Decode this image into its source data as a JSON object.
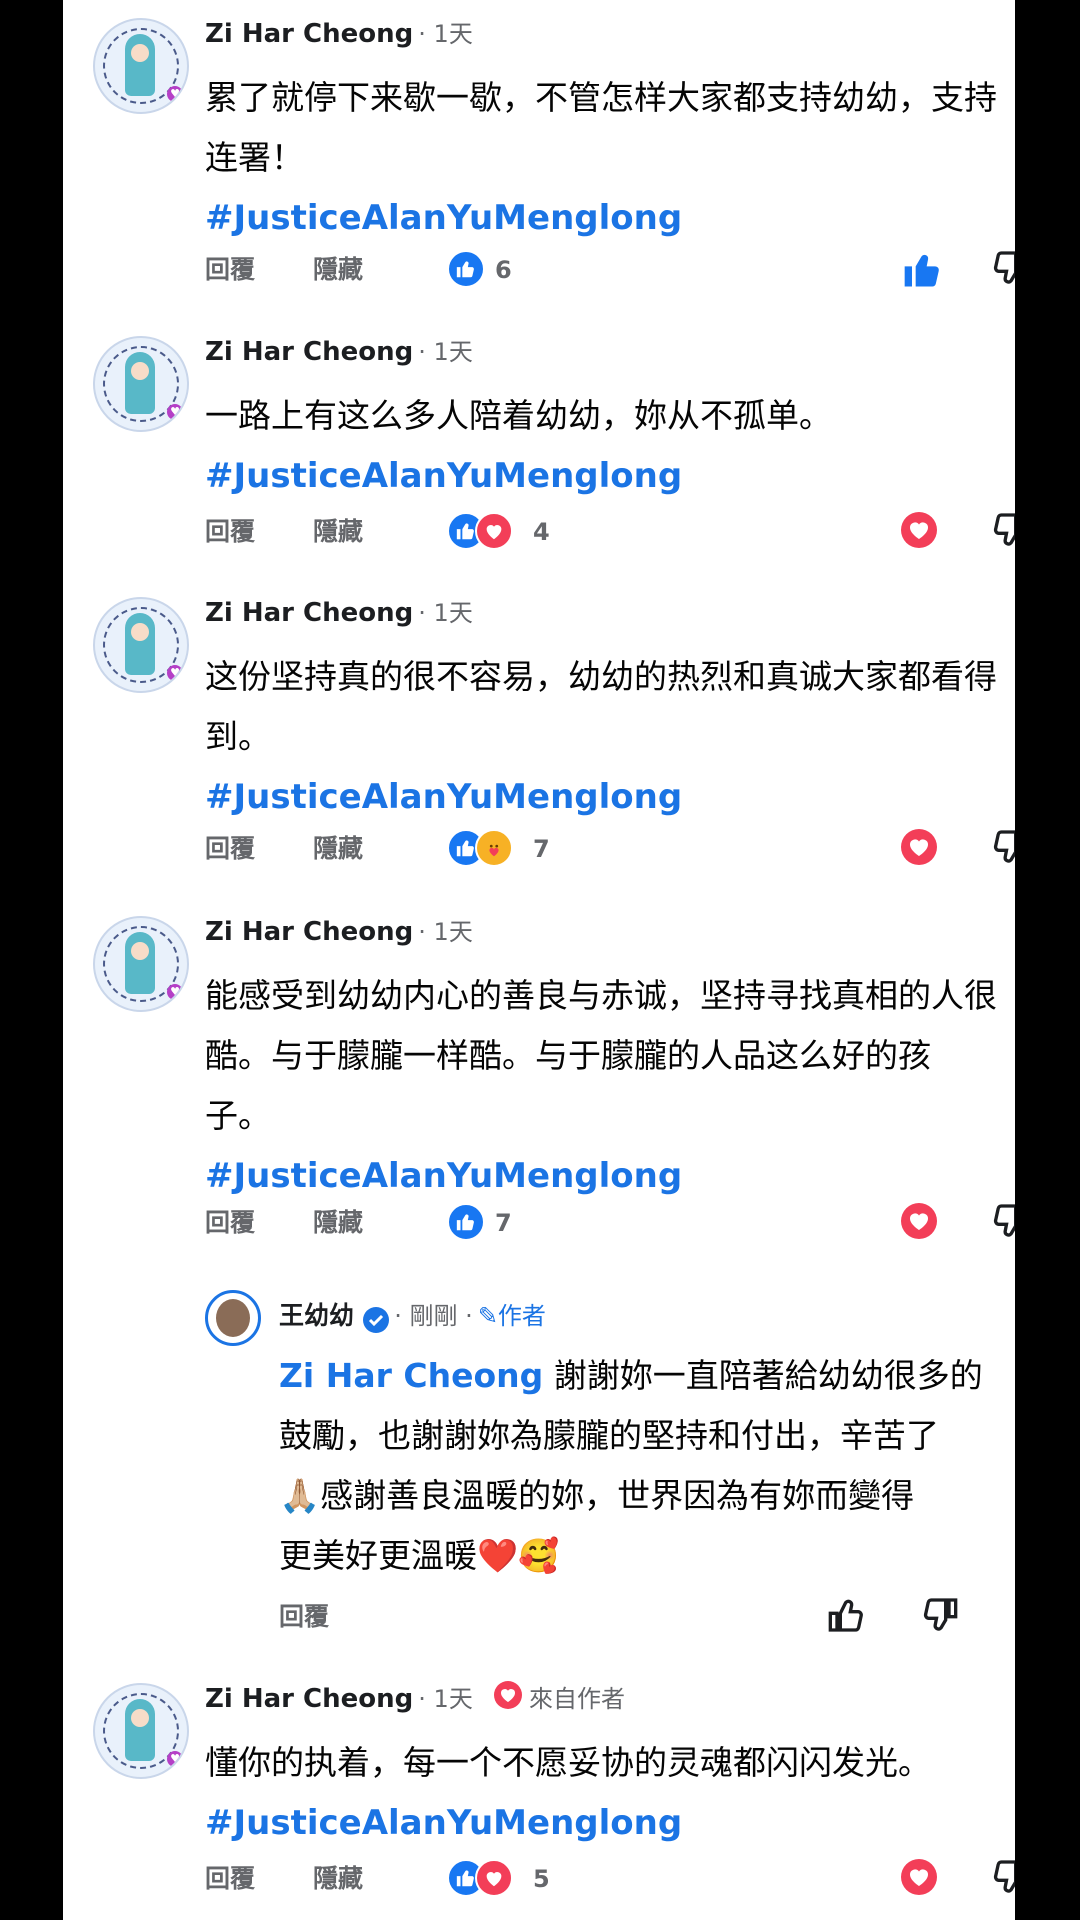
{
  "comments": [
    {
      "author": "Zi Har Cheong",
      "time": "· 1天",
      "text": "累了就停下来歇一歇，不管怎样大家都支持幼幼，支持连署！",
      "hashtag": "#JusticeAlanYuMenglong",
      "reply_label": "回覆",
      "hide_label": "隱藏",
      "reaction_count": "6"
    },
    {
      "author": "Zi Har Cheong",
      "time": "· 1天",
      "text": "一路上有这么多人陪着幼幼，妳从不孤单。",
      "hashtag": "#JusticeAlanYuMenglong",
      "reply_label": "回覆",
      "hide_label": "隱藏",
      "reaction_count": "4"
    },
    {
      "author": "Zi Har Cheong",
      "time": "· 1天",
      "text": "这份坚持真的很不容易，幼幼的热烈和真诚大家都看得到。",
      "hashtag": "#JusticeAlanYuMenglong",
      "reply_label": "回覆",
      "hide_label": "隱藏",
      "reaction_count": "7"
    },
    {
      "author": "Zi Har Cheong",
      "time": "· 1天",
      "text": "能感受到幼幼内心的善良与赤诚，坚持寻找真相的人很酷。与于朦朧一样酷。与于朦朧的人品这么好的孩 子。",
      "hashtag": "#JusticeAlanYuMenglong",
      "reply_label": "回覆",
      "hide_label": "隱藏",
      "reaction_count": "7"
    },
    {
      "author": "Zi Har Cheong",
      "time": "· 1天",
      "loved_by_author": "來自作者",
      "text": "懂你的执着，每一个不愿妥协的灵魂都闪闪发光。",
      "hashtag": "#JusticeAlanYuMenglong",
      "reply_label": "回覆",
      "hide_label": "隱藏",
      "reaction_count": "5"
    }
  ],
  "reply": {
    "author": "王幼幼",
    "time": "· 剛剛 ·",
    "author_badge": "作者",
    "mention": "Zi Har Cheong",
    "text_line1": " 謝謝妳一直陪著給幼幼很多的",
    "text_line2": "鼓勵，也謝謝妳為朦朧的堅持和付出，辛苦了",
    "text_line3": "🙏🏼感謝善良溫暖的妳，世界因為有妳而變得",
    "text_line4": "更美好更溫暖❤️🥰",
    "reply_label": "回覆"
  },
  "colors": {
    "link": "#1b74e4",
    "like": "#1877f2",
    "love": "#f33e58",
    "muted": "#65676b"
  }
}
